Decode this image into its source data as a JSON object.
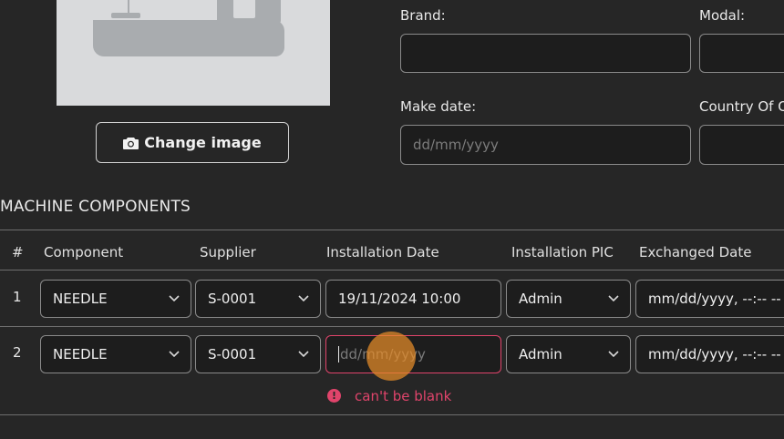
{
  "image_section": {
    "change_image_label": "Change image"
  },
  "form": {
    "brand_label": "Brand:",
    "modal_label": "Modal:",
    "make_date_label": "Make date:",
    "make_date_placeholder": "dd/mm/yyyy",
    "country_label": "Country Of O"
  },
  "components": {
    "title": "MACHINE COMPONENTS",
    "headers": [
      "#",
      "Component",
      "Supplier",
      "Installation Date",
      "Installation PIC",
      "Exchanged Date"
    ],
    "rows": [
      {
        "num": "1",
        "component": "NEEDLE",
        "supplier": "S-0001",
        "installation_date": "19/11/2024 10:00",
        "pic": "Admin",
        "exchanged_date": "mm/dd/yyyy, --:-- --"
      },
      {
        "num": "2",
        "component": "NEEDLE",
        "supplier": "S-0001",
        "installation_date_placeholder": "dd/mm/yyyy",
        "pic": "Admin",
        "exchanged_date": "mm/dd/yyyy, --:-- --",
        "error": "can't be blank"
      }
    ]
  },
  "colors": {
    "background": "#262626",
    "error": "#e0446b",
    "cursor_highlight": "#e68c28"
  }
}
